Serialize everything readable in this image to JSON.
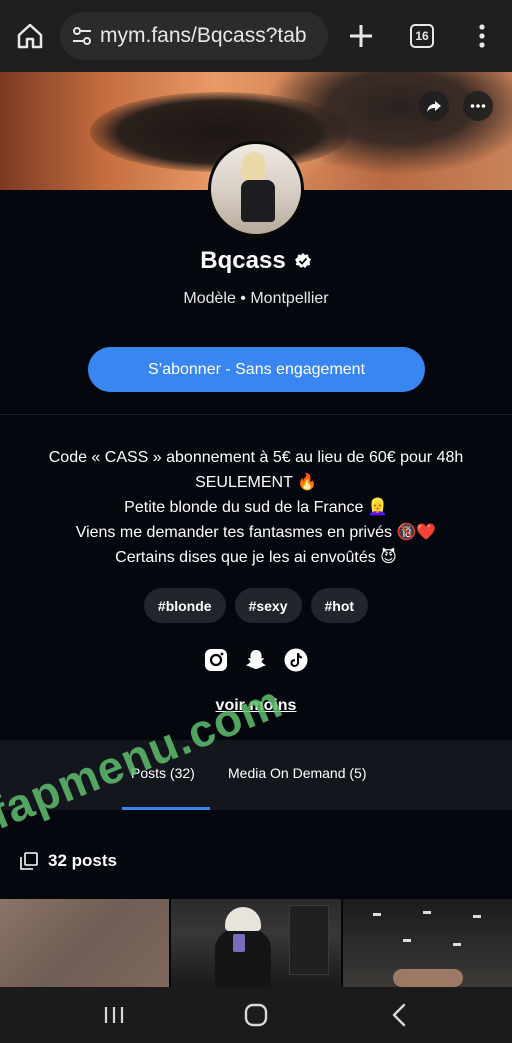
{
  "browser": {
    "url": "mym.fans/Bqcass?tab",
    "tab_count": "16"
  },
  "profile": {
    "name": "Bqcass",
    "subtitle": "Modèle • Montpellier",
    "subscribe_label": "S’abonner - Sans engagement",
    "bio": [
      "Code « CASS » abonnement à 5€ au lieu de 60€ pour 48h SEULEMENT 🔥",
      "Petite blonde du sud de la France 👱‍♀️",
      "Viens me demander tes fantasmes en privés 🔞❤️",
      "Certains dises que je les ai envoûtés 😈"
    ],
    "tags": [
      "#blonde",
      "#sexy",
      "#hot"
    ],
    "socials": [
      "instagram-icon",
      "snapchat-icon",
      "tiktok-icon"
    ],
    "voir_moins": "voir moins"
  },
  "tabs": {
    "posts": "Posts (32)",
    "media": "Media On Demand (5)"
  },
  "posts": {
    "count_label": "32 posts"
  },
  "watermark": {
    "text1": "fapmenu.com",
    "text2": "fapmenu"
  },
  "colors": {
    "accent": "#3a86f0",
    "background": "#05070e",
    "tag_bg": "#22252c",
    "watermark": "#62be6e"
  }
}
